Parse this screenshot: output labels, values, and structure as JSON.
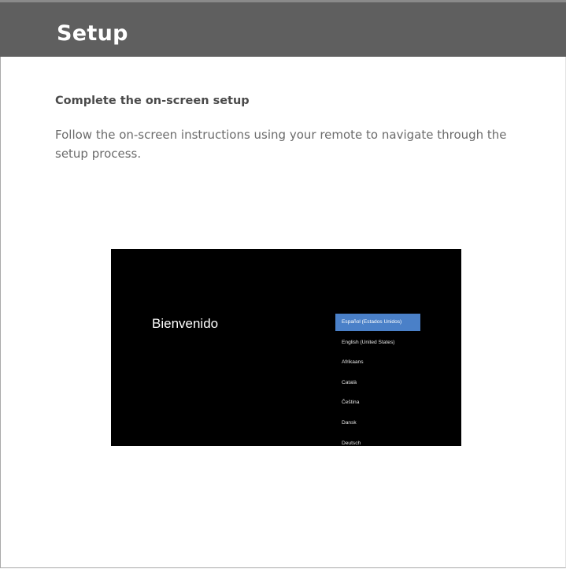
{
  "header": {
    "title": "Setup"
  },
  "section": {
    "heading": "Complete the on-screen setup",
    "instructions": "Follow the on-screen instructions using your remote to navigate through the setup process."
  },
  "tv_screen": {
    "welcome": "Bienvenido",
    "languages": [
      {
        "label": "Español (Estados Unidos)",
        "selected": true
      },
      {
        "label": "English (United States)",
        "selected": false
      },
      {
        "label": "Afrikaans",
        "selected": false
      },
      {
        "label": "Català",
        "selected": false
      },
      {
        "label": "Čeština",
        "selected": false
      },
      {
        "label": "Dansk",
        "selected": false
      },
      {
        "label": "Deutsch",
        "selected": false
      }
    ],
    "colors": {
      "background": "#000000",
      "selection": "#4a80c8",
      "text": "#ffffff"
    }
  },
  "colors": {
    "header_bg": "#5f5f5f",
    "heading_text": "#4a4a4a",
    "body_text": "#6b6b6b"
  }
}
